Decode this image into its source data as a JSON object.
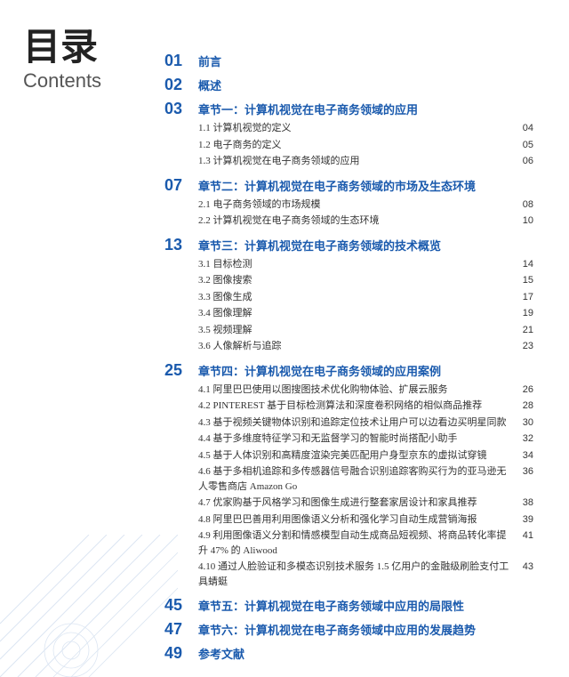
{
  "title": {
    "chinese": "目录",
    "english": "Contents"
  },
  "toc": [
    {
      "num": "01",
      "label": "前言",
      "items": []
    },
    {
      "num": "02",
      "label": "概述",
      "items": []
    },
    {
      "num": "03",
      "label": "章节一：计算机视觉在电子商务领域的应用",
      "items": [
        {
          "text": "1.1 计算机视觉的定义",
          "page": "04"
        },
        {
          "text": "1.2 电子商务的定义",
          "page": "05"
        },
        {
          "text": "1.3 计算机视觉在电子商务领域的应用",
          "page": "06"
        }
      ]
    },
    {
      "num": "07",
      "label": "章节二：计算机视觉在电子商务领域的市场及生态环境",
      "items": [
        {
          "text": "2.1 电子商务领域的市场规模",
          "page": "08"
        },
        {
          "text": "2.2 计算机视觉在电子商务领域的生态环境",
          "page": "10"
        }
      ]
    },
    {
      "num": "13",
      "label": "章节三：计算机视觉在电子商务领域的技术概览",
      "items": [
        {
          "text": "3.1 目标检测",
          "page": "14"
        },
        {
          "text": "3.2 图像搜索",
          "page": "15"
        },
        {
          "text": "3.3 图像生成",
          "page": "17"
        },
        {
          "text": "3.4 图像理解",
          "page": "19"
        },
        {
          "text": "3.5 视频理解",
          "page": "21"
        },
        {
          "text": "3.6 人像解析与追踪",
          "page": "23"
        }
      ]
    },
    {
      "num": "25",
      "label": "章节四：计算机视觉在电子商务领域的应用案例",
      "items": [
        {
          "text": "4.1 阿里巴巴使用以图搜图技术优化购物体验、扩展云服务",
          "page": "26"
        },
        {
          "text": "4.2 PINTEREST 基于目标检测算法和深度卷积网络的相似商品推荐",
          "page": "28"
        },
        {
          "text": "4.3 基于视频关键物体识别和追踪定位技术让用户可以边看边买明星同款",
          "page": "30"
        },
        {
          "text": "4.4 基于多维度特征学习和无监督学习的智能时尚搭配小助手",
          "page": "32"
        },
        {
          "text": "4.5 基于人体识别和高精度渲染完美匹配用户身型京东的虚拟试穿镜",
          "page": "34"
        },
        {
          "text": "4.6 基于多相机追踪和多传感器信号融合识别追踪客购买行为的亚马逊无人零售商店 Amazon Go",
          "page": "36"
        },
        {
          "text": "4.7 优家购基于风格学习和图像生成进行整套家居设计和家具推荐",
          "page": "38"
        },
        {
          "text": "4.8 阿里巴巴善用利用图像语义分析和强化学习自动生成营销海报",
          "page": "39"
        },
        {
          "text": "4.9 利用图像语义分割和情感模型自动生成商品短视频、将商品转化率提升 47% 的 Aliwood",
          "page": "41"
        },
        {
          "text": "4.10 通过人脸验证和多模态识别技术服务 1.5 亿用户的金融级刷脸支付工具蜻蜓",
          "page": "43"
        }
      ]
    },
    {
      "num": "45",
      "label": "章节五：计算机视觉在电子商务领域中应用的局限性",
      "items": []
    },
    {
      "num": "47",
      "label": "章节六：计算机视觉在电子商务领域中应用的发展趋势",
      "items": []
    },
    {
      "num": "49",
      "label": "参考文献",
      "items": []
    }
  ]
}
